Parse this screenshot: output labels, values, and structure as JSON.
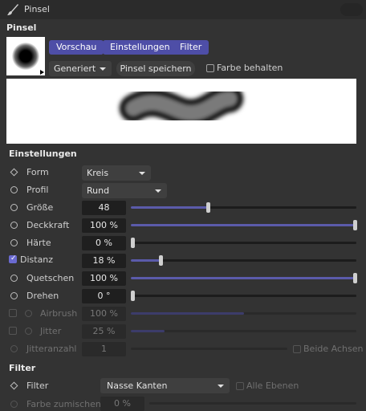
{
  "title": "Pinsel",
  "brush_section": "Pinsel",
  "tabs": [
    "Vorschau",
    "Einstellungen",
    "Filter"
  ],
  "generated": "Generiert",
  "save_button": "Pinsel speichern",
  "keep_color": "Farbe behalten",
  "settings_title": "Einstellungen",
  "rows": {
    "form": {
      "label": "Form",
      "value": "Kreis"
    },
    "profil": {
      "label": "Profil",
      "value": "Rund"
    },
    "groesse": {
      "label": "Größe",
      "value": "48",
      "level": 0.34
    },
    "deckkraft": {
      "label": "Deckkraft",
      "value": "100 %",
      "level": 1.0
    },
    "haerte": {
      "label": "Härte",
      "value": "0 %",
      "level": 0.0
    },
    "distanz": {
      "label": "Distanz",
      "value": "18 %",
      "level": 0.13
    },
    "quetschen": {
      "label": "Quetschen",
      "value": "100 %",
      "level": 1.0
    },
    "drehen": {
      "label": "Drehen",
      "value": "0 °",
      "level": 0.0
    },
    "airbrush": {
      "label": "Airbrush",
      "value": "100 %",
      "level": 0.5
    },
    "jitter": {
      "label": "Jitter",
      "value": "25 %",
      "level": 0.15
    },
    "jitteranzahl": {
      "label": "Jitteranzahl",
      "value": "1"
    }
  },
  "beide_achsen": "Beide Achsen",
  "filter_title": "Filter",
  "filter_row": {
    "label": "Filter",
    "value": "Nasse Kanten"
  },
  "alle_ebenen": "Alle Ebenen",
  "farbe_zumischen": {
    "label": "Farbe zumischen",
    "value": "0 %"
  },
  "colors": {
    "accent": "#4e4ea7",
    "slider_fill": "#5b5baa",
    "background": "#333333"
  },
  "icons": [
    "brush-icon",
    "dropdown-arrow-icon",
    "radio-icon",
    "diamond-keyframe-icon",
    "checkbox-icon"
  ]
}
